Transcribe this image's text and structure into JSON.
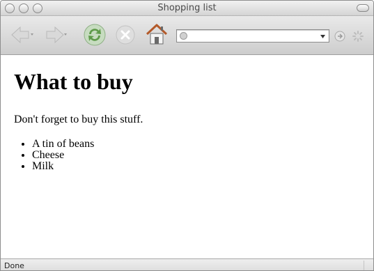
{
  "window": {
    "title": "Shopping list"
  },
  "toolbar": {
    "url_value": ""
  },
  "page": {
    "heading": "What to buy",
    "intro": "Don't forget to buy this stuff.",
    "items": [
      "A tin of beans",
      "Cheese",
      "Milk"
    ]
  },
  "statusbar": {
    "text": "Done"
  },
  "icons": {
    "back": "back-arrow-icon",
    "forward": "forward-arrow-icon",
    "reload": "reload-icon",
    "stop": "stop-icon",
    "home": "home-icon",
    "site": "site-icon",
    "dropdown": "dropdown-icon",
    "go": "go-icon",
    "spinner": "throbber-icon"
  },
  "colors": {
    "reload_green": "#5f9b4a",
    "home_roof": "#b35a2a"
  }
}
